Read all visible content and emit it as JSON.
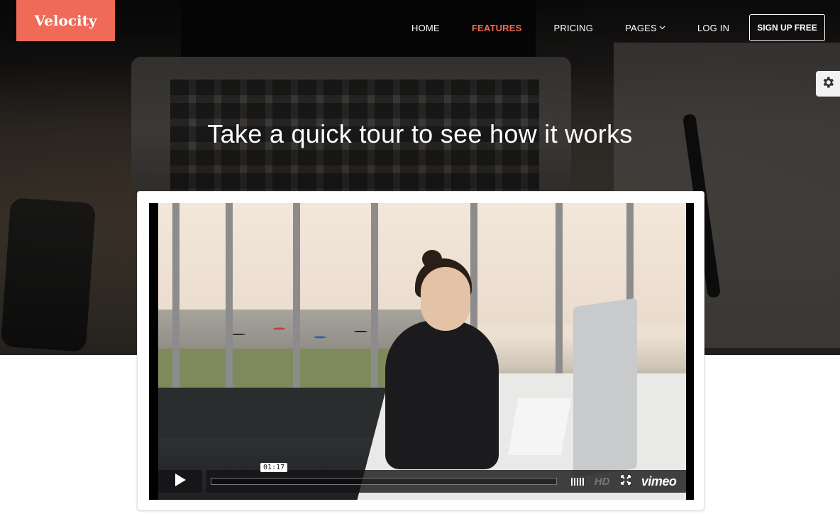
{
  "brand": {
    "name": "Velocity",
    "color": "#ef6a57"
  },
  "nav": {
    "items": [
      {
        "label": "HOME",
        "active": false
      },
      {
        "label": "FEATURES",
        "active": true
      },
      {
        "label": "PRICING",
        "active": false
      },
      {
        "label": "PAGES",
        "active": false,
        "has_dropdown": true
      },
      {
        "label": "LOG IN",
        "active": false
      }
    ],
    "cta_label": "SIGN UP FREE"
  },
  "settings": {
    "icon": "gear-icon"
  },
  "hero": {
    "headline": "Take a quick tour to see how it works"
  },
  "video": {
    "timecode": "01:17",
    "progress": 0,
    "hd_label": "HD",
    "provider_label": "vimeo",
    "icons": [
      "play-icon",
      "volume-icon",
      "fullscreen-icon"
    ]
  }
}
